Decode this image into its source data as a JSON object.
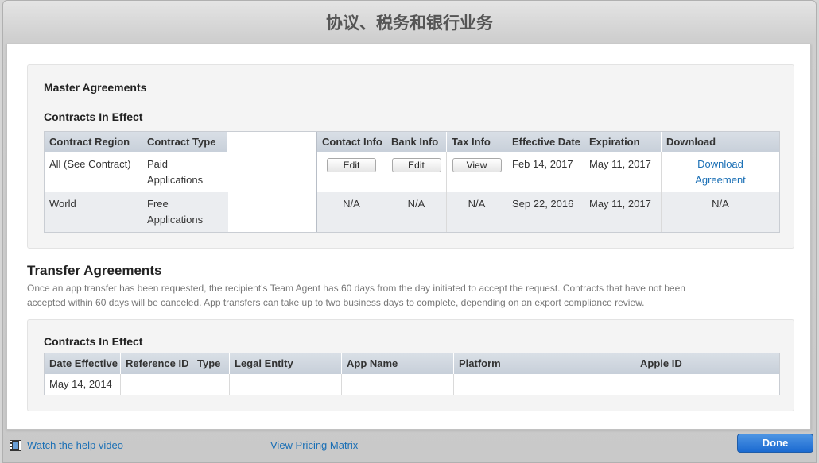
{
  "window": {
    "title": "协议、税务和银行业务"
  },
  "master": {
    "heading": "Master Agreements",
    "subheading": "Contracts In Effect",
    "columns": [
      "Contract Region",
      "Contract Type",
      "Contact Info",
      "Bank Info",
      "Tax Info",
      "Effective Date",
      "Expiration",
      "Download"
    ],
    "rows": [
      {
        "region": "All (See Contract)",
        "type_line1": "Paid",
        "type_line2": "Applications",
        "contact": "Edit",
        "bank": "Edit",
        "tax": "View",
        "effective": "Feb 14, 2017",
        "expiration": "May 11, 2017",
        "download_line1": "Download",
        "download_line2": "Agreement"
      },
      {
        "region": "World",
        "type_line1": "Free",
        "type_line2": "Applications",
        "contact": "N/A",
        "bank": "N/A",
        "tax": "N/A",
        "effective": "Sep 22, 2016",
        "expiration": "May 11, 2017",
        "download": "N/A"
      }
    ]
  },
  "transfer": {
    "heading": "Transfer Agreements",
    "description_line1": "Once an app transfer has been requested, the recipient's Team Agent has 60 days from the day initiated to accept the request. Contracts that have not been",
    "description_line2": "accepted within 60 days will be canceled. App transfers can take up to two business days to complete, depending on an export compliance review.",
    "subheading": "Contracts In Effect",
    "columns": [
      "Date Effective",
      "Reference ID",
      "Type",
      "Legal Entity",
      "App Name",
      "Platform",
      "Apple ID"
    ],
    "rows": [
      {
        "date": "May 14, 2014"
      }
    ]
  },
  "footer": {
    "help_video": "Watch the help video",
    "pricing": "View Pricing Matrix",
    "done": "Done"
  },
  "colors": {
    "link": "#1a6fb5",
    "header_bg": "#c7cfd9",
    "done_bg": "#1b6ad1"
  }
}
